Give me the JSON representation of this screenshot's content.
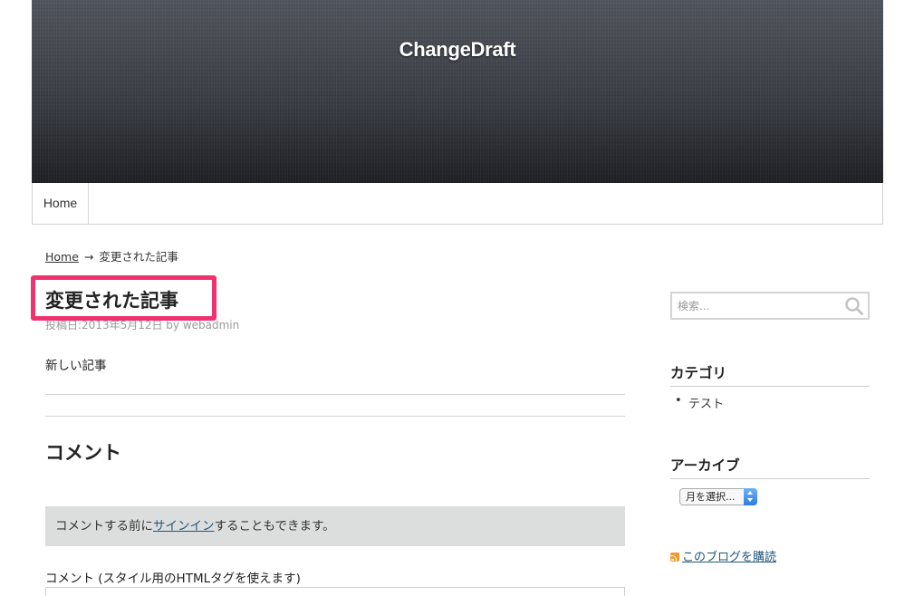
{
  "site": {
    "title": "ChangeDraft"
  },
  "nav": {
    "items": [
      {
        "label": "Home"
      }
    ]
  },
  "breadcrumb": {
    "home": "Home",
    "arrow": "→",
    "current": "変更された記事"
  },
  "post": {
    "title": "変更された記事",
    "meta": "投稿日:2013年5月12日 by webadmin",
    "body": "新しい記事"
  },
  "comments": {
    "title": "コメント",
    "notice_before": "コメントする前に",
    "notice_link": "サインイン",
    "notice_after": "することもできます。",
    "label": "コメント (スタイル用のHTMLタグを使えます)"
  },
  "sidebar": {
    "search": {
      "placeholder": "検索..."
    },
    "categories": {
      "title": "カテゴリ",
      "items": [
        "テスト"
      ]
    },
    "archives": {
      "title": "アーカイブ",
      "select_value": "月を選択..."
    },
    "subscribe": {
      "label": "このブログを購読"
    }
  },
  "colors": {
    "highlight": "#f0336f",
    "link": "#21577a",
    "notice_bg": "#dcdedd"
  },
  "icons": {
    "search": "search-icon",
    "rss": "rss-icon",
    "select": "select-arrows-icon"
  }
}
